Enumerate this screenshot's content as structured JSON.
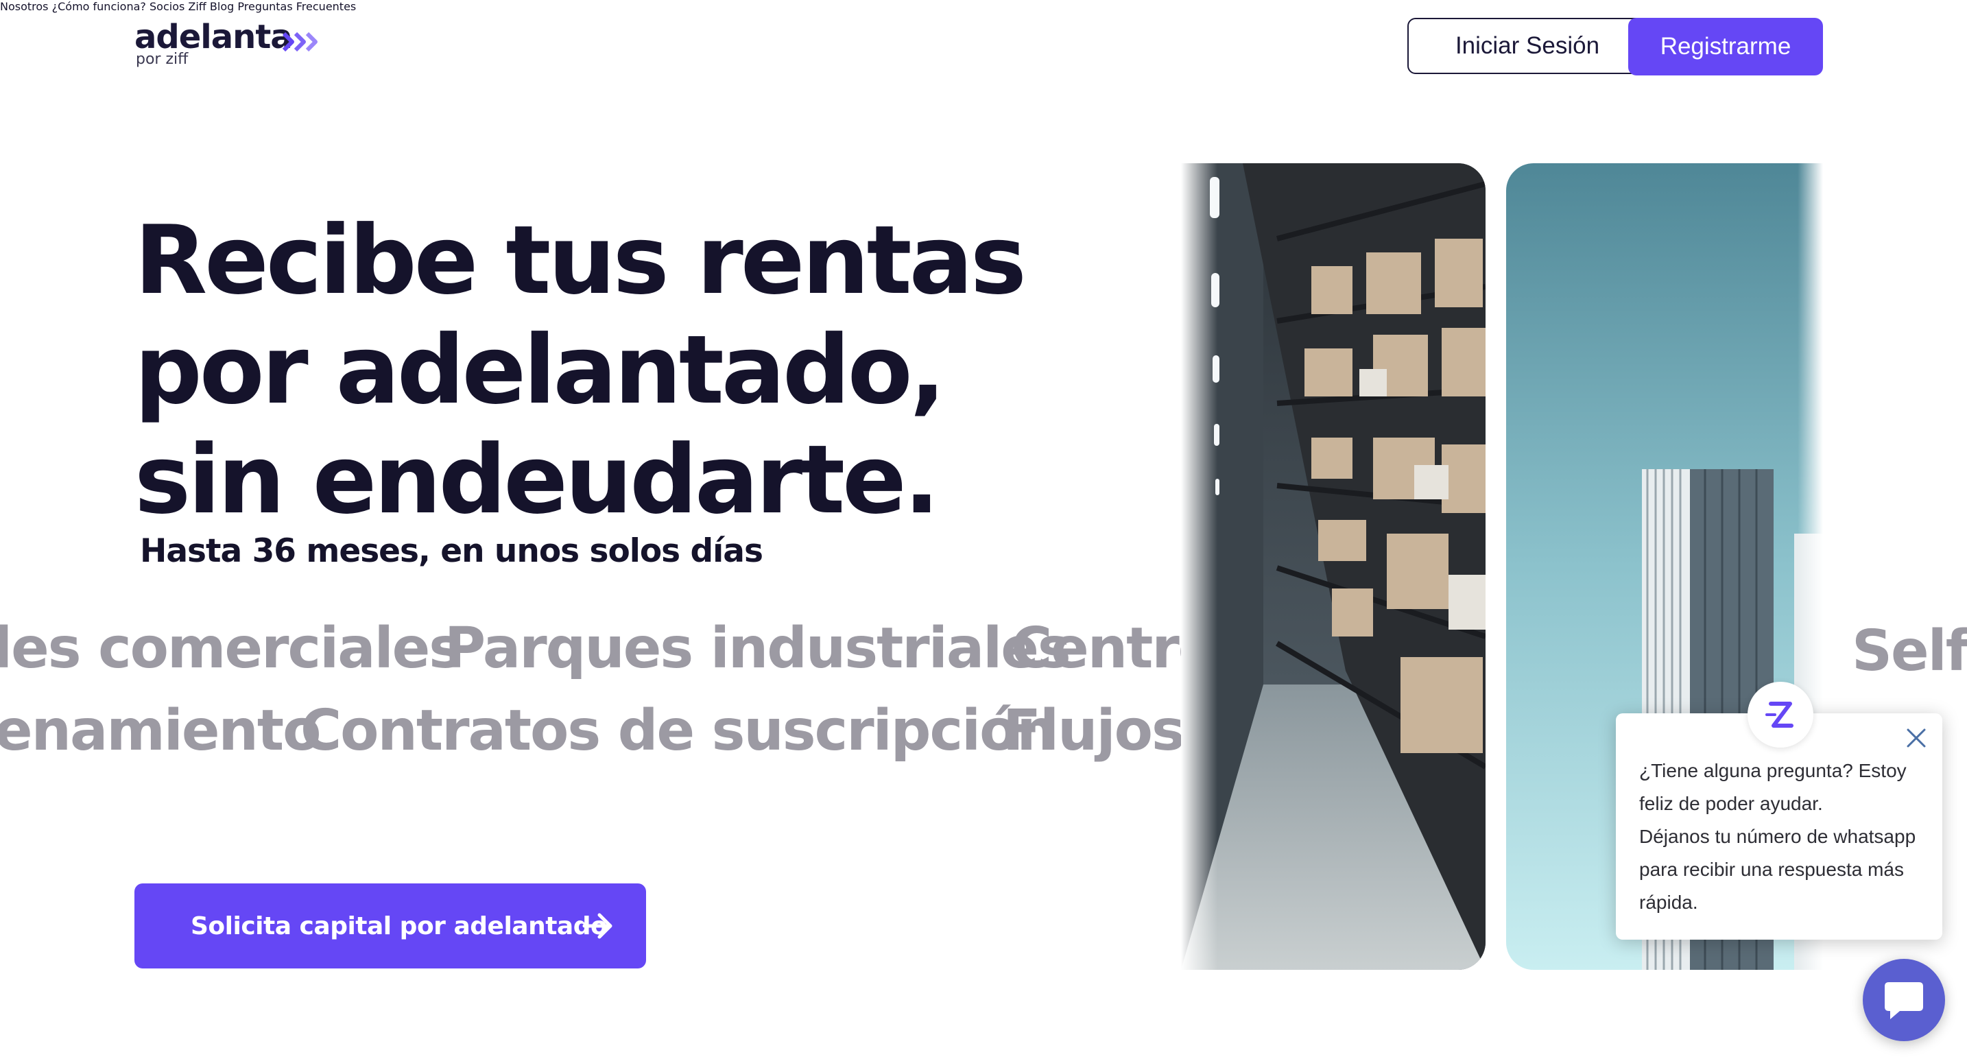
{
  "brand": {
    "name": "adelanta",
    "tagline": "por ziff",
    "accent": "#6547f5",
    "text_dark": "#15132b"
  },
  "nav": {
    "items": [
      {
        "label": "Nosotros"
      },
      {
        "label": "¿Cómo funciona?"
      },
      {
        "label": "Socios Ziff"
      },
      {
        "label": "Blog"
      },
      {
        "label": "Preguntas Frecuentes"
      }
    ],
    "login_label": "Iniciar Sesión",
    "register_label": "Registrarme"
  },
  "hero": {
    "headline_lines": [
      "Recibe tus rentas",
      "por adelantado,",
      "sin endeudarte."
    ],
    "subhead": "Hasta 36 meses, en unos solos días",
    "marquee_row1": [
      "les comerciales",
      "Parques industriales",
      "Centro"
    ],
    "marquee_row2": [
      "enamiento",
      "Contratos de suscripción",
      "Flujos d"
    ],
    "marquee_right": "Self",
    "cta_label": "Solicita capital por adelantado",
    "cta_icon": "arrow-right-icon"
  },
  "images": {
    "left": "warehouse-shelves-photo",
    "right": "skyscraper-photo"
  },
  "chat": {
    "message_lines": [
      "¿Tiene alguna pregunta? Estoy",
      "feliz de poder ayudar.",
      "Déjanos tu número de whatsapp",
      "para recibir una respuesta más",
      "rápida."
    ],
    "avatar_icon": "ziff-z-logo-icon",
    "launcher_icon": "chat-bubble-icon",
    "close_icon": "close-icon"
  }
}
